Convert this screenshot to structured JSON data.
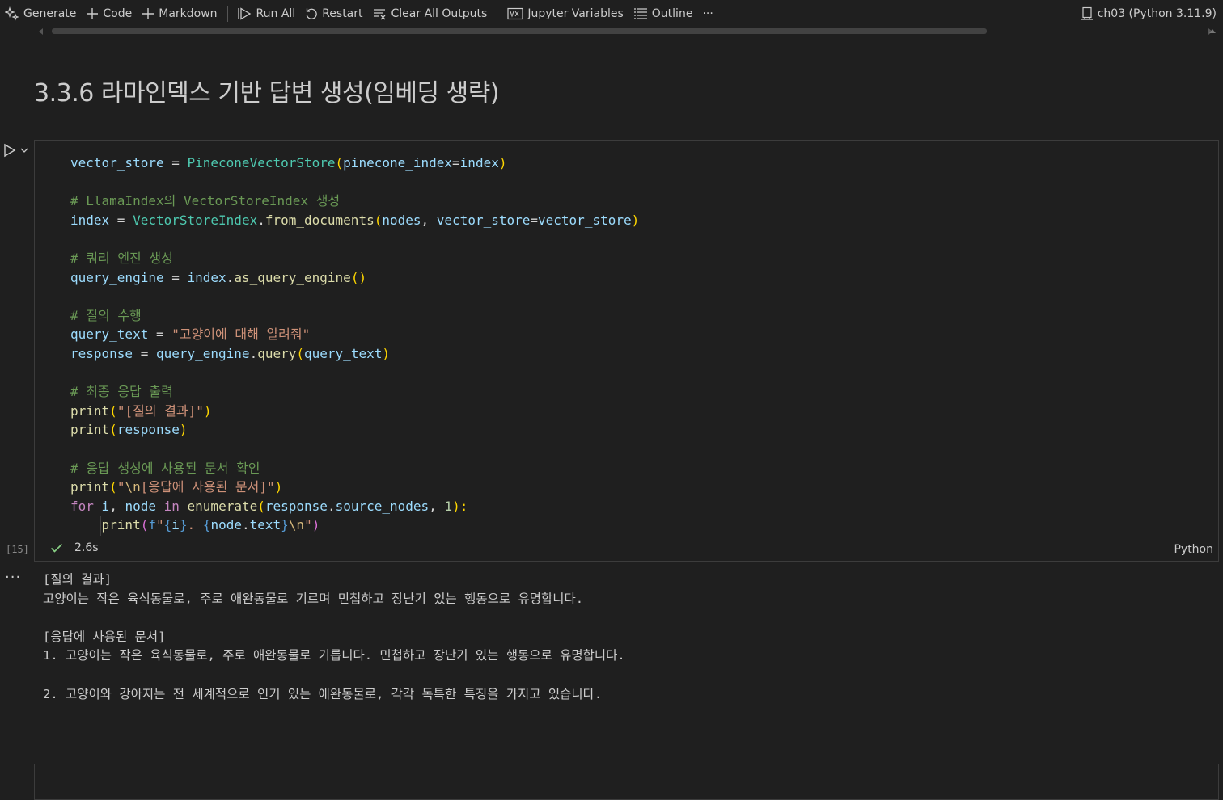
{
  "toolbar": {
    "generate": "Generate",
    "code": "Code",
    "markdown": "Markdown",
    "run_all": "Run All",
    "restart": "Restart",
    "clear_all_outputs": "Clear All Outputs",
    "jupyter_variables": "Jupyter Variables",
    "outline": "Outline",
    "more": "···",
    "kernel": "ch03 (Python 3.11.9)"
  },
  "markdown_cell": {
    "heading": "3.3.6 라마인덱스 기반 답변 생성(임베딩 생략)"
  },
  "code_cell": {
    "execution_count": "[15]",
    "duration": "2.6s",
    "language": "Python",
    "lines": [
      [
        [
          "var",
          "vector_store"
        ],
        [
          "op",
          " = "
        ],
        [
          "cls",
          "PineconeVectorStore"
        ],
        [
          "p1",
          "("
        ],
        [
          "var",
          "pinecone_index"
        ],
        [
          "op",
          "="
        ],
        [
          "var",
          "index"
        ],
        [
          "p1",
          ")"
        ]
      ],
      [],
      [
        [
          "cm",
          "# LlamaIndex의 VectorStoreIndex 생성"
        ]
      ],
      [
        [
          "var",
          "index"
        ],
        [
          "op",
          " = "
        ],
        [
          "cls",
          "VectorStoreIndex"
        ],
        [
          "op",
          "."
        ],
        [
          "fn",
          "from_documents"
        ],
        [
          "p1",
          "("
        ],
        [
          "var",
          "nodes"
        ],
        [
          "op",
          ", "
        ],
        [
          "var",
          "vector_store"
        ],
        [
          "op",
          "="
        ],
        [
          "var",
          "vector_store"
        ],
        [
          "p1",
          ")"
        ]
      ],
      [],
      [
        [
          "cm",
          "# 쿼리 엔진 생성"
        ]
      ],
      [
        [
          "var",
          "query_engine"
        ],
        [
          "op",
          " = "
        ],
        [
          "var",
          "index"
        ],
        [
          "op",
          "."
        ],
        [
          "fn",
          "as_query_engine"
        ],
        [
          "p1",
          "()"
        ]
      ],
      [],
      [
        [
          "cm",
          "# 질의 수행"
        ]
      ],
      [
        [
          "var",
          "query_text"
        ],
        [
          "op",
          " = "
        ],
        [
          "str",
          "\"고양이에 대해 알려줘\""
        ]
      ],
      [
        [
          "var",
          "response"
        ],
        [
          "op",
          " = "
        ],
        [
          "var",
          "query_engine"
        ],
        [
          "op",
          "."
        ],
        [
          "fn",
          "query"
        ],
        [
          "p1",
          "("
        ],
        [
          "var",
          "query_text"
        ],
        [
          "p1",
          ")"
        ]
      ],
      [],
      [
        [
          "cm",
          "# 최종 응답 출력"
        ]
      ],
      [
        [
          "fn",
          "print"
        ],
        [
          "p1",
          "("
        ],
        [
          "str",
          "\"[질의 결과]\""
        ],
        [
          "p1",
          ")"
        ]
      ],
      [
        [
          "fn",
          "print"
        ],
        [
          "p1",
          "("
        ],
        [
          "var",
          "response"
        ],
        [
          "p1",
          ")"
        ]
      ],
      [],
      [
        [
          "cm",
          "# 응답 생성에 사용된 문서 확인"
        ]
      ],
      [
        [
          "fn",
          "print"
        ],
        [
          "p1",
          "("
        ],
        [
          "str",
          "\""
        ],
        [
          "esc",
          "\\n"
        ],
        [
          "str",
          "[응답에 사용된 문서]\""
        ],
        [
          "p1",
          ")"
        ]
      ],
      [
        [
          "ctl",
          "for"
        ],
        [
          "op",
          " "
        ],
        [
          "var",
          "i"
        ],
        [
          "op",
          ", "
        ],
        [
          "var",
          "node"
        ],
        [
          "op",
          " "
        ],
        [
          "ctl",
          "in"
        ],
        [
          "op",
          " "
        ],
        [
          "fn",
          "enumerate"
        ],
        [
          "p1",
          "("
        ],
        [
          "var",
          "response"
        ],
        [
          "op",
          "."
        ],
        [
          "var",
          "source_nodes"
        ],
        [
          "op",
          ", "
        ],
        [
          "num",
          "1"
        ],
        [
          "p1",
          "):"
        ]
      ],
      [
        [
          "op",
          "    "
        ],
        [
          "fn",
          "print"
        ],
        [
          "p2",
          "("
        ],
        [
          "kw",
          "f"
        ],
        [
          "str",
          "\""
        ],
        [
          "kw",
          "{"
        ],
        [
          "var",
          "i"
        ],
        [
          "kw",
          "}"
        ],
        [
          "str",
          ". "
        ],
        [
          "kw",
          "{"
        ],
        [
          "var",
          "node"
        ],
        [
          "op",
          "."
        ],
        [
          "var",
          "text"
        ],
        [
          "kw",
          "}"
        ],
        [
          "esc",
          "\\n"
        ],
        [
          "str",
          "\""
        ],
        [
          "p2",
          ")"
        ]
      ]
    ]
  },
  "output": {
    "lines": [
      "[질의 결과]",
      "고양이는 작은 육식동물로, 주로 애완동물로 기르며 민첩하고 장난기 있는 행동으로 유명합니다.",
      "",
      "[응답에 사용된 문서]",
      "1. 고양이는 작은 육식동물로, 주로 애완동물로 기릅니다. 민첩하고 장난기 있는 행동으로 유명합니다.",
      "",
      "2. 고양이와 강아지는 전 세계적으로 인기 있는 애완동물로, 각각 독특한 특징을 가지고 있습니다."
    ]
  },
  "colors": {
    "background": "#1f1f1f",
    "cell_border": "#3c3c3c",
    "success_check": "#89d185"
  }
}
